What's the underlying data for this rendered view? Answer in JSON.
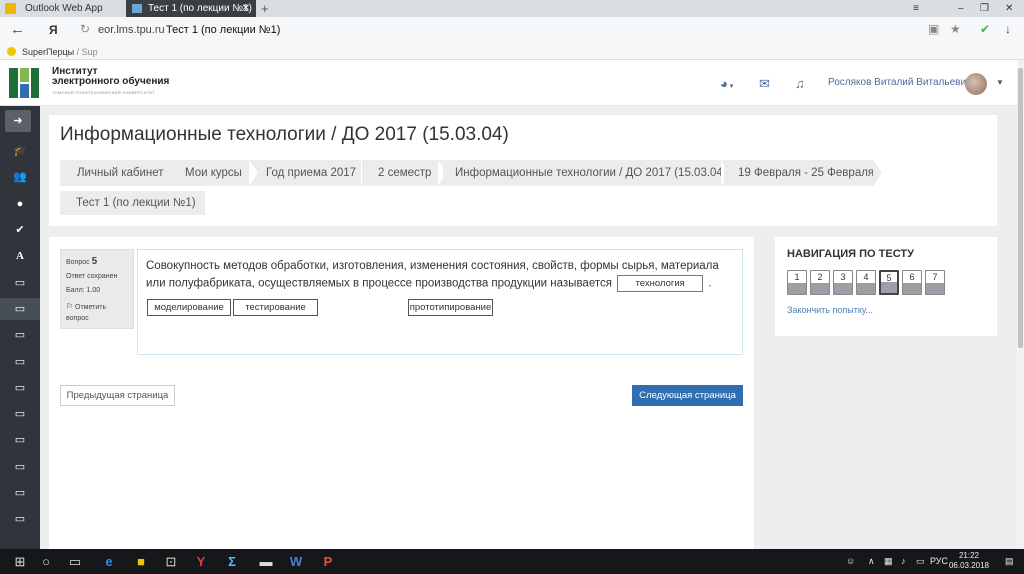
{
  "browser": {
    "tabs": [
      {
        "label": "Outlook Web App",
        "active": false
      },
      {
        "label": "Тест 1 (по лекции №1)",
        "active": true
      }
    ],
    "new_tab": "+",
    "window_controls": [
      "–",
      "❐",
      "✕"
    ],
    "address": {
      "domain": "eor.lms.tpu.ru",
      "title": "Тест 1 (по лекции №1)"
    },
    "yandex_logo": "Я",
    "bookmark": {
      "label": "SuperПерцы",
      "sub": "/ Sup"
    }
  },
  "header": {
    "brand_line1": "Институт",
    "brand_line2": "электронного обучения",
    "brand_small": "ТОМСКИЙ ПОЛИТЕХНИЧЕСКИЙ УНИВЕРСИТЕТ",
    "user_name": "Росляков Виталий Витальевич",
    "icons": [
      "globe-icon",
      "mail-icon",
      "bell-icon"
    ]
  },
  "sidebar": {
    "icons": [
      "arrow-right-icon",
      "graduation-cap-icon",
      "users-icon",
      "circle-icon",
      "check-circle-icon",
      "font-icon",
      "folder-icon",
      "folder-icon",
      "folder-icon",
      "folder-icon",
      "folder-icon",
      "folder-icon",
      "folder-icon",
      "folder-icon",
      "folder-icon"
    ]
  },
  "page": {
    "title": "Информационные технологии / ДО 2017 (15.03.04)",
    "breadcrumbs": [
      "Личный кабинет",
      "Мои курсы",
      "Год приема 2017",
      "2 семестр",
      "Информационные технологии / ДО 2017 (15.03.04)",
      "19 Февраля - 25 Февраля"
    ],
    "sub_crumb": "Тест 1 (по лекции №1)"
  },
  "question": {
    "label": "Вопрос",
    "number": "5",
    "status": "Ответ сохранен",
    "score": "Балл: 1.00",
    "flag_line1": "Отметить",
    "flag_line2": "вопрос",
    "text_part1": "Совокупность методов обработки, изготовления, изменения состояния, свойств, формы сырья, материала или полуфабриката, осуществляемых в процессе производства продукции называется",
    "dropped_answer": "технология",
    "text_end": ".",
    "choices": [
      "моделирование",
      "тестирование",
      "прототипирование"
    ]
  },
  "buttons": {
    "prev": "Предыдущая страница",
    "next": "Следующая страница"
  },
  "quiz_nav": {
    "title": "НАВИГАЦИЯ ПО ТЕСТУ",
    "items": [
      "1",
      "2",
      "3",
      "4",
      "5",
      "6",
      "7"
    ],
    "current": "5",
    "finish": "Закончить попытку..."
  },
  "taskbar": {
    "lang": "РУС",
    "time": "21:22",
    "date": "06.03.2018"
  },
  "colors": {
    "sidebar": "#30353b",
    "primary_button": "#2f6fb1",
    "link": "#4a7fb5"
  }
}
